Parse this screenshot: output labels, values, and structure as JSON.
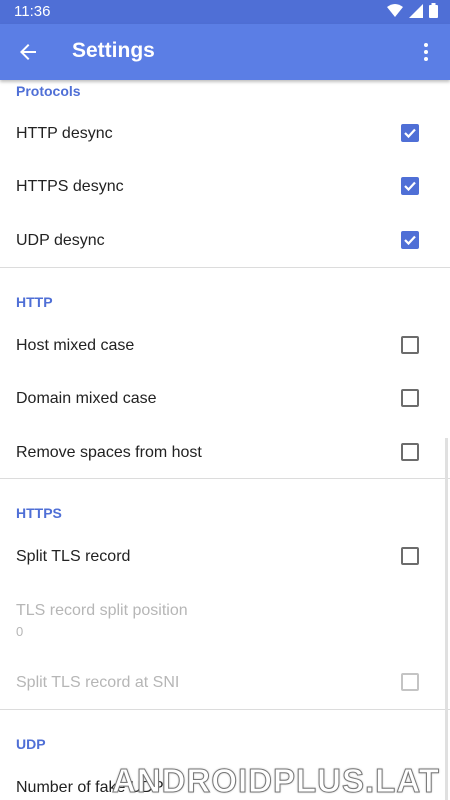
{
  "status_bar": {
    "time": "11:36"
  },
  "app_bar": {
    "title": "Settings",
    "back_icon": "arrow-back-icon",
    "more_icon": "more-vert-icon"
  },
  "sections": {
    "protocols": {
      "header": "Protocols",
      "items": [
        {
          "label": "HTTP desync",
          "checked": true
        },
        {
          "label": "HTTPS desync",
          "checked": true
        },
        {
          "label": "UDP desync",
          "checked": true
        }
      ]
    },
    "http": {
      "header": "HTTP",
      "items": [
        {
          "label": "Host mixed case",
          "checked": false
        },
        {
          "label": "Domain mixed case",
          "checked": false
        },
        {
          "label": "Remove spaces from host",
          "checked": false
        }
      ]
    },
    "https": {
      "header": "HTTPS",
      "items": [
        {
          "label": "Split TLS record",
          "checked": false
        },
        {
          "label": "TLS record split position",
          "value": "0",
          "disabled": true
        },
        {
          "label": "Split TLS record at SNI",
          "checked": false,
          "disabled": true
        }
      ]
    },
    "udp": {
      "header": "UDP",
      "items": [
        {
          "label": "Number of fake UDP"
        }
      ]
    }
  },
  "watermark": "ANDROIDPLUS.LAT",
  "colors": {
    "primary": "#5b7ee5",
    "status": "#4f6fd6",
    "accent": "#4f6fd6"
  }
}
